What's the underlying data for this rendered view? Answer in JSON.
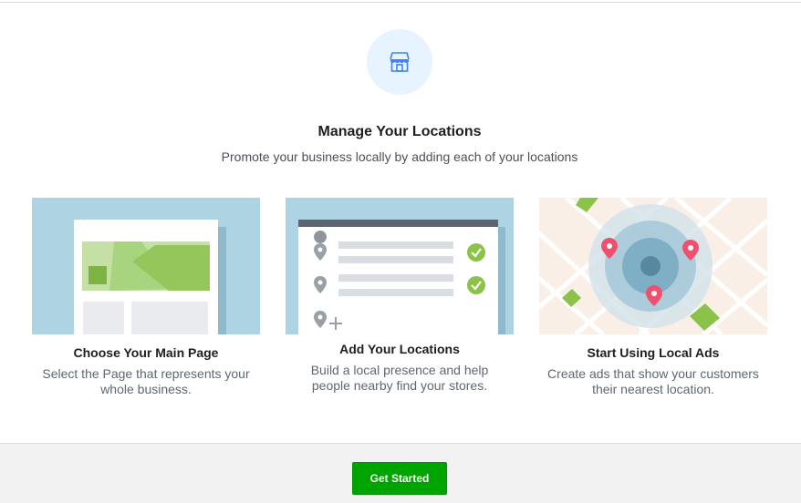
{
  "header": {
    "icon": "store-icon",
    "title": "Manage Your Locations",
    "subtitle": "Promote your business locally by adding each of your locations"
  },
  "cards": [
    {
      "illustration": "page-preview-illustration",
      "title": "Choose Your Main Page",
      "description": "Select the Page that represents your whole business."
    },
    {
      "illustration": "location-list-illustration",
      "title": "Add Your Locations",
      "description": "Build a local presence and help people nearby find your stores."
    },
    {
      "illustration": "local-ads-map-illustration",
      "title": "Start Using Local Ads",
      "description": "Create ads that show your customers their nearest location."
    }
  ],
  "footer": {
    "button_label": "Get Started"
  },
  "colors": {
    "accent_blue": "#4080ff",
    "cta_green": "#00a400",
    "icon_bg": "#e7f3fe",
    "card_bg_blue": "#a8d0e0",
    "pin_red": "#f0506e",
    "check_green": "#8bc34a"
  }
}
